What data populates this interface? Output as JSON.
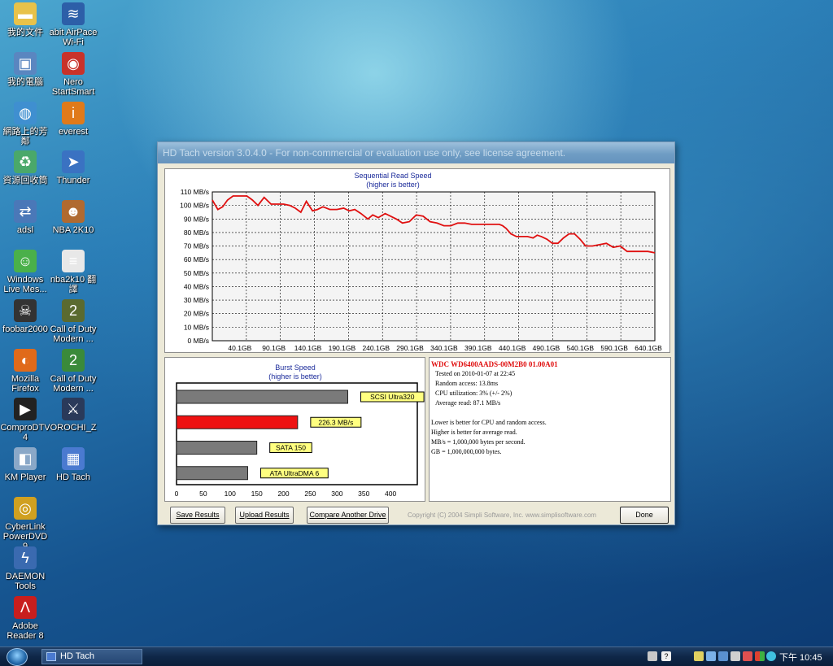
{
  "desktop": {
    "icons": [
      {
        "label": "我的文件",
        "icon": "folder-icon",
        "color": "#e8c24a"
      },
      {
        "label": "abit AirPace Wi-Fi",
        "icon": "wifi-router-icon",
        "color": "#2d5fa8"
      },
      {
        "label": "我的電腦",
        "icon": "computer-icon",
        "color": "#5a86c0"
      },
      {
        "label": "Nero StartSmart",
        "icon": "nero-icon",
        "color": "#c8322a"
      },
      {
        "label": "網路上的芳鄰",
        "icon": "network-icon",
        "color": "#3f8fd0"
      },
      {
        "label": "everest",
        "icon": "info-icon",
        "color": "#e07a1a"
      },
      {
        "label": "資源回收筒",
        "icon": "recycle-bin-icon",
        "color": "#4aa86a"
      },
      {
        "label": "Thunder",
        "icon": "thunder-icon",
        "color": "#3a72c2"
      },
      {
        "label": "adsl",
        "icon": "adsl-icon",
        "color": "#4a78b8"
      },
      {
        "label": "NBA 2K10",
        "icon": "nba-icon",
        "color": "#b06a30"
      },
      {
        "label": "Windows Live Mes...",
        "icon": "messenger-icon",
        "color": "#4ab04a"
      },
      {
        "label": "nba2k10 翻譯",
        "icon": "document-icon",
        "color": "#e8e8e8"
      },
      {
        "label": "foobar2000",
        "icon": "foobar-icon",
        "color": "#333333"
      },
      {
        "label": "Call of Duty Modern ...",
        "icon": "cod-icon",
        "color": "#5a6a30"
      },
      {
        "label": "Mozilla Firefox",
        "icon": "firefox-icon",
        "color": "#e06a1a"
      },
      {
        "label": "Call of Duty Modern ...",
        "icon": "cod2-icon",
        "color": "#3a8a3a"
      },
      {
        "label": "ComproDTV 4",
        "icon": "tv-icon",
        "color": "#222222"
      },
      {
        "label": "OROCHI_Z",
        "icon": "orochi-icon",
        "color": "#2a3a5a"
      },
      {
        "label": "KM Player",
        "icon": "media-player-icon",
        "color": "#8aa8c8"
      },
      {
        "label": "HD Tach",
        "icon": "hdtach-icon",
        "color": "#4a7ad0"
      },
      {
        "label": "CyberLink PowerDVD 9",
        "icon": "powerdvd-icon",
        "color": "#d0a020"
      },
      {
        "label": "DAEMON Tools",
        "icon": "daemon-icon",
        "color": "#3a6ab0"
      },
      {
        "label": "Adobe Reader 8",
        "icon": "pdf-icon",
        "color": "#c81e1e"
      }
    ]
  },
  "window": {
    "title": "HD Tach version 3.0.4.0  - For non-commercial or evaluation use only, see license agreement.",
    "buttons": {
      "save": "Save Results",
      "upload": "Upload Results",
      "compare": "Compare Another Drive",
      "done": "Done"
    },
    "copyright": "Copyright (C) 2004 Simpli Software, Inc. www.simplisoftware.com"
  },
  "info": {
    "drive": "WDC WD6400AADS-00M2B0 01.00A01",
    "tested": "Tested on 2010-01-07 at 22:45",
    "random_access": "Random access: 13.8ms",
    "cpu": "CPU utilization: 3% (+/- 2%)",
    "avg_read": "Average read: 87.1 MB/s",
    "note1": "Lower is better for CPU and random access.",
    "note2": "Higher is better for average read.",
    "note3": "MB/s = 1,000,000 bytes per second.",
    "note4": "GB = 1,000,000,000 bytes."
  },
  "taskbar": {
    "task_label": "HD Tach",
    "clock": "下午 10:45"
  },
  "chart_data": [
    {
      "type": "line",
      "title": "Sequential Read Speed",
      "subtitle": "(higher is better)",
      "xlabel": "",
      "ylabel": "",
      "x_ticks": [
        "40.1GB",
        "90.1GB",
        "140.1GB",
        "190.1GB",
        "240.1GB",
        "290.1GB",
        "340.1GB",
        "390.1GB",
        "440.1GB",
        "490.1GB",
        "540.1GB",
        "590.1GB",
        "640.1GB"
      ],
      "y_ticks": [
        "0 MB/s",
        "10 MB/s",
        "20 MB/s",
        "30 MB/s",
        "40 MB/s",
        "50 MB/s",
        "60 MB/s",
        "70 MB/s",
        "80 MB/s",
        "90 MB/s",
        "100 MB/s",
        "110 MB/s"
      ],
      "xlim": [
        0,
        640.1
      ],
      "ylim": [
        0,
        110
      ],
      "grid": true,
      "color": "#e01010",
      "x": [
        0,
        8,
        15,
        22,
        30,
        40,
        50,
        58,
        66,
        75,
        85,
        95,
        103,
        112,
        120,
        128,
        136,
        145,
        152,
        160,
        170,
        180,
        190,
        198,
        206,
        215,
        225,
        232,
        240,
        250,
        258,
        266,
        275,
        285,
        295,
        305,
        315,
        325,
        335,
        345,
        355,
        365,
        375,
        385,
        395,
        405,
        415,
        420,
        425,
        432,
        440,
        448,
        456,
        464,
        470,
        476,
        484,
        492,
        500,
        508,
        516,
        524,
        532,
        540,
        550,
        560,
        570,
        580,
        590,
        600,
        610,
        620,
        630,
        640.1
      ],
      "y": [
        104,
        97,
        99,
        104,
        107,
        107,
        107,
        104,
        100,
        106,
        101,
        101,
        101,
        100,
        98,
        95,
        103,
        96,
        97,
        99,
        97,
        97,
        98,
        96,
        97,
        94,
        90,
        93,
        91,
        94,
        92,
        90,
        87,
        88,
        93,
        92,
        88,
        87,
        85,
        85,
        87,
        87,
        86,
        86,
        86,
        86,
        86,
        85,
        83,
        79,
        77,
        77,
        77,
        76,
        78,
        77,
        75,
        72,
        72,
        76,
        79,
        79,
        75,
        70,
        70,
        71,
        72,
        69,
        70,
        66,
        66,
        66,
        66,
        65
      ]
    },
    {
      "type": "bar",
      "title": "Burst Speed",
      "subtitle": "(higher is better)",
      "xlim": [
        0,
        450
      ],
      "x_ticks": [
        "0",
        "50",
        "100",
        "150",
        "200",
        "250",
        "300",
        "350",
        "400"
      ],
      "bars": [
        {
          "label": "SCSI Ultra320",
          "value": 320,
          "color": "#7a7a7a"
        },
        {
          "label": "226.3 MB/s",
          "value": 226.3,
          "color": "#ee1111"
        },
        {
          "label": "SATA 150",
          "value": 150,
          "color": "#7a7a7a"
        },
        {
          "label": "ATA UltraDMA 6",
          "value": 133,
          "color": "#7a7a7a"
        }
      ]
    }
  ]
}
